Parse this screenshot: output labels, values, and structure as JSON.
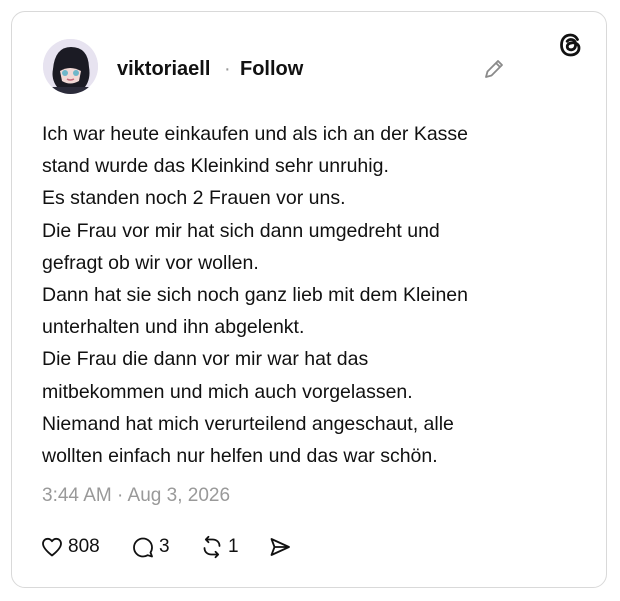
{
  "post": {
    "username": "viktoriaell",
    "separator": "·",
    "follow_label": "Follow",
    "text_lines": [
      "Ich war heute einkaufen und als ich an der Kasse",
      "stand wurde das Kleinkind sehr unruhig.",
      "Es standen noch 2 Frauen vor uns.",
      "Die Frau vor mir hat sich dann umgedreht und",
      "gefragt ob wir vor wollen.",
      "Dann hat sie sich noch ganz lieb mit dem Kleinen",
      "unterhalten und ihn abgelenkt.",
      "Die Frau die dann vor mir war hat das",
      "mitbekommen und mich auch vorgelassen.",
      "Niemand hat mich verurteilend angeschaut, alle",
      "wollten einfach nur helfen und das war schön."
    ],
    "timestamp": "3:44 AM · Aug 3, 2026",
    "likes": "808",
    "replies": "3",
    "reposts": "1"
  },
  "icons": {
    "brand": "threads-logo-icon",
    "edit": "pencil-icon",
    "like": "heart-icon",
    "reply": "speech-bubble-icon",
    "repost": "repost-icon",
    "share": "send-icon"
  }
}
